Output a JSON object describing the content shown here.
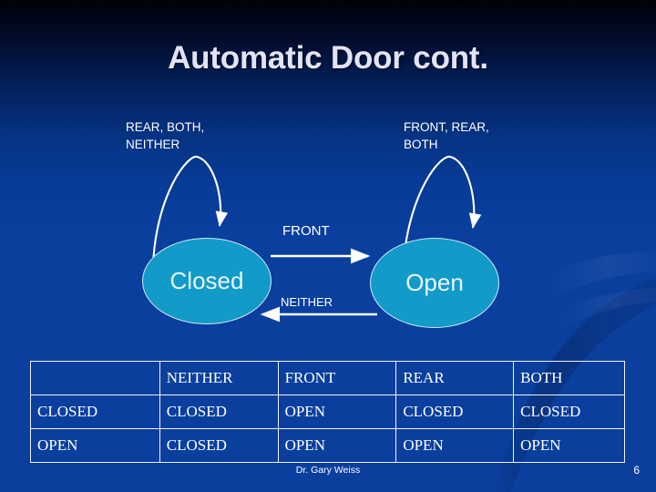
{
  "slide": {
    "title": "Automatic Door cont.",
    "background_top_color": "#000208",
    "background_bottom_color": "#0a3fa0",
    "accent_state_color": "#129ac8",
    "text_color": "#ffffff",
    "title_color": "#e2e3f4"
  },
  "diagram": {
    "self_loop_captions": {
      "left": [
        "REAR, BOTH,",
        "NEITHER"
      ],
      "right": [
        "FRONT, REAR,",
        "BOTH"
      ]
    },
    "states": [
      {
        "id": "closed",
        "label": "Closed"
      },
      {
        "id": "open",
        "label": "Open"
      }
    ],
    "transitions": [
      {
        "from": "closed",
        "to": "open",
        "label": "FRONT"
      },
      {
        "from": "open",
        "to": "closed",
        "label": "NEITHER"
      },
      {
        "from": "closed",
        "to": "closed",
        "label": "REAR, BOTH, NEITHER"
      },
      {
        "from": "open",
        "to": "open",
        "label": "FRONT, REAR, BOTH"
      }
    ]
  },
  "table": {
    "headers": [
      "",
      "NEITHER",
      "FRONT",
      "REAR",
      "BOTH"
    ],
    "rows": [
      [
        "CLOSED",
        "CLOSED",
        "OPEN",
        "CLOSED",
        "CLOSED"
      ],
      [
        "OPEN",
        "CLOSED",
        "OPEN",
        "OPEN",
        "OPEN"
      ]
    ]
  },
  "footer": {
    "author": "Dr. Gary Weiss",
    "page_number": "6"
  }
}
